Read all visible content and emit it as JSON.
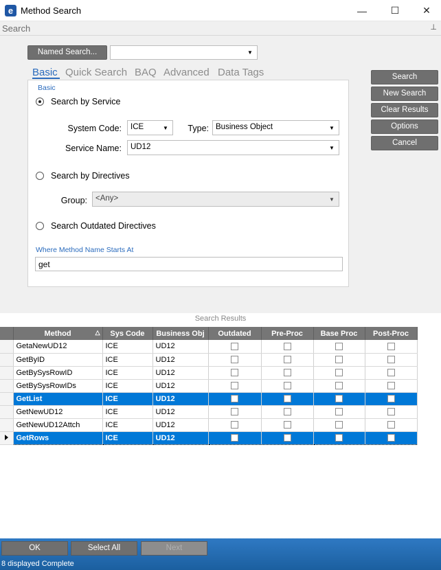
{
  "window": {
    "title": "Method Search",
    "logo_letter": "e",
    "minimize_glyph": "—",
    "maximize_glyph": "☐",
    "close_glyph": "✕"
  },
  "search_header": {
    "label": "Search",
    "pin_glyph": "⊥"
  },
  "named_search": {
    "button_label": "Named Search...",
    "value": ""
  },
  "tabs": [
    "Basic",
    "Quick Search",
    "BAQ",
    "Advanced",
    "Data Tags"
  ],
  "active_tab": "Basic",
  "side_buttons": {
    "search": "Search",
    "new_search": "New Search",
    "clear_results": "Clear Results",
    "options": "Options",
    "cancel": "Cancel"
  },
  "basic": {
    "caption": "Basic",
    "by_service": {
      "label": "Search by Service",
      "checked": true,
      "system_code_label": "System Code:",
      "system_code": "ICE",
      "type_label": "Type:",
      "type": "Business Object",
      "service_name_label": "Service Name:",
      "service_name": "UD12"
    },
    "by_directives": {
      "label": "Search by Directives",
      "checked": false,
      "group_label": "Group:",
      "group": "<Any>"
    },
    "outdated": {
      "label": "Search Outdated Directives",
      "checked": false
    },
    "starts_at_label": "Where Method Name Starts At",
    "starts_at_value": "get"
  },
  "results": {
    "caption": "Search Results",
    "columns": [
      "Method",
      "Sys Code",
      "Business Obj",
      "Outdated",
      "Pre-Proc",
      "Base Proc",
      "Post-Proc"
    ],
    "rows": [
      {
        "method": "GetaNewUD12",
        "sys": "ICE",
        "obj": "UD12",
        "selected": false,
        "current": false
      },
      {
        "method": "GetByID",
        "sys": "ICE",
        "obj": "UD12",
        "selected": false,
        "current": false
      },
      {
        "method": "GetBySysRowID",
        "sys": "ICE",
        "obj": "UD12",
        "selected": false,
        "current": false
      },
      {
        "method": "GetBySysRowIDs",
        "sys": "ICE",
        "obj": "UD12",
        "selected": false,
        "current": false
      },
      {
        "method": "GetList",
        "sys": "ICE",
        "obj": "UD12",
        "selected": true,
        "current": false
      },
      {
        "method": "GetNewUD12",
        "sys": "ICE",
        "obj": "UD12",
        "selected": false,
        "current": false
      },
      {
        "method": "GetNewUD12Attch",
        "sys": "ICE",
        "obj": "UD12",
        "selected": false,
        "current": false
      },
      {
        "method": "GetRows",
        "sys": "ICE",
        "obj": "UD12",
        "selected": true,
        "current": true
      }
    ]
  },
  "footer": {
    "ok": "OK",
    "select_all": "Select All",
    "next": "Next",
    "status": "8 displayed Complete"
  },
  "colors": {
    "accent": "#2a6bbd",
    "selection": "#0078d7",
    "button": "#6f6f6f",
    "footer": "#1b5f9f"
  }
}
